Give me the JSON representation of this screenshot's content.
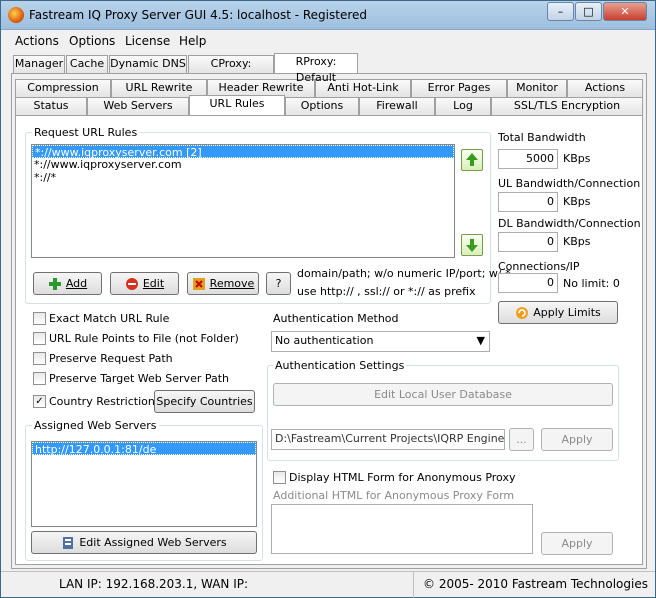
{
  "window": {
    "title": "Fastream IQ Proxy Server GUI 4.5: localhost - Registered",
    "min": "–",
    "max": "□",
    "close": "✕"
  },
  "menu": [
    "Actions",
    "Options",
    "License",
    "Help"
  ],
  "top_tabs": [
    "Manager",
    "Cache",
    "Dynamic DNS",
    "CProxy: Default",
    "RProxy: Default"
  ],
  "tabs_row1": [
    "Compression",
    "URL Rewrite",
    "Header Rewrite",
    "Anti Hot-Link",
    "Error Pages",
    "Monitor",
    "Actions"
  ],
  "tabs_row2": [
    "Status",
    "Web Servers",
    "URL Rules",
    "Options",
    "Firewall",
    "Log",
    "SSL/TLS Encryption"
  ],
  "request_rules": {
    "label": "Request URL Rules",
    "items": [
      "*://www.iqproxyserver.com [2]",
      "*://www.iqproxyserver.com",
      "*://*"
    ]
  },
  "buttons": {
    "add": "Add",
    "edit": "Edit",
    "remove": "Remove",
    "help": "?",
    "apply_limits": "Apply Limits",
    "specify_countries": "Specify Countries",
    "edit_local_db": "Edit Local User Database",
    "browse": "...",
    "apply": "Apply",
    "apply2": "Apply",
    "edit_assigned": "Edit Assigned Web Servers"
  },
  "hint": {
    "line1": "domain/path; w/o numeric IP/port; w/ *",
    "line2": "use http:// , ssl:// or *:// as prefix"
  },
  "bandwidth": {
    "total_label": "Total Bandwidth",
    "total_value": "5000",
    "total_unit": "KBps",
    "ul_label": "UL Bandwidth/Connection",
    "ul_value": "0",
    "ul_unit": "KBps",
    "dl_label": "DL Bandwidth/Connection",
    "dl_value": "0",
    "dl_unit": "KBps",
    "conn_label": "Connections/IP",
    "conn_value": "0",
    "conn_note": "No limit: 0"
  },
  "checks": [
    {
      "label": "Exact Match URL Rule",
      "checked": false
    },
    {
      "label": "URL Rule Points to File (not Folder)",
      "checked": false
    },
    {
      "label": "Preserve Request Path",
      "checked": false
    },
    {
      "label": "Preserve Target Web Server Path",
      "checked": false
    },
    {
      "label": "Country Restriction",
      "checked": true
    }
  ],
  "auth": {
    "method_label": "Authentication Method",
    "method_value": "No authentication",
    "settings_label": "Authentication Settings",
    "path_value": "D:\\Fastream\\Current Projects\\IQRP Engine\\Rel",
    "form_check": "Display HTML Form for Anonymous Proxy",
    "form_label": "Additional HTML for Anonymous Proxy Form"
  },
  "assigned": {
    "label": "Assigned Web Servers",
    "items": [
      "http://127.0.0.1:81/de"
    ]
  },
  "status": {
    "ips": "LAN IP: 192.168.203.1, WAN IP:",
    "copyright": "© 2005- 2010 Fastream Technologies"
  }
}
